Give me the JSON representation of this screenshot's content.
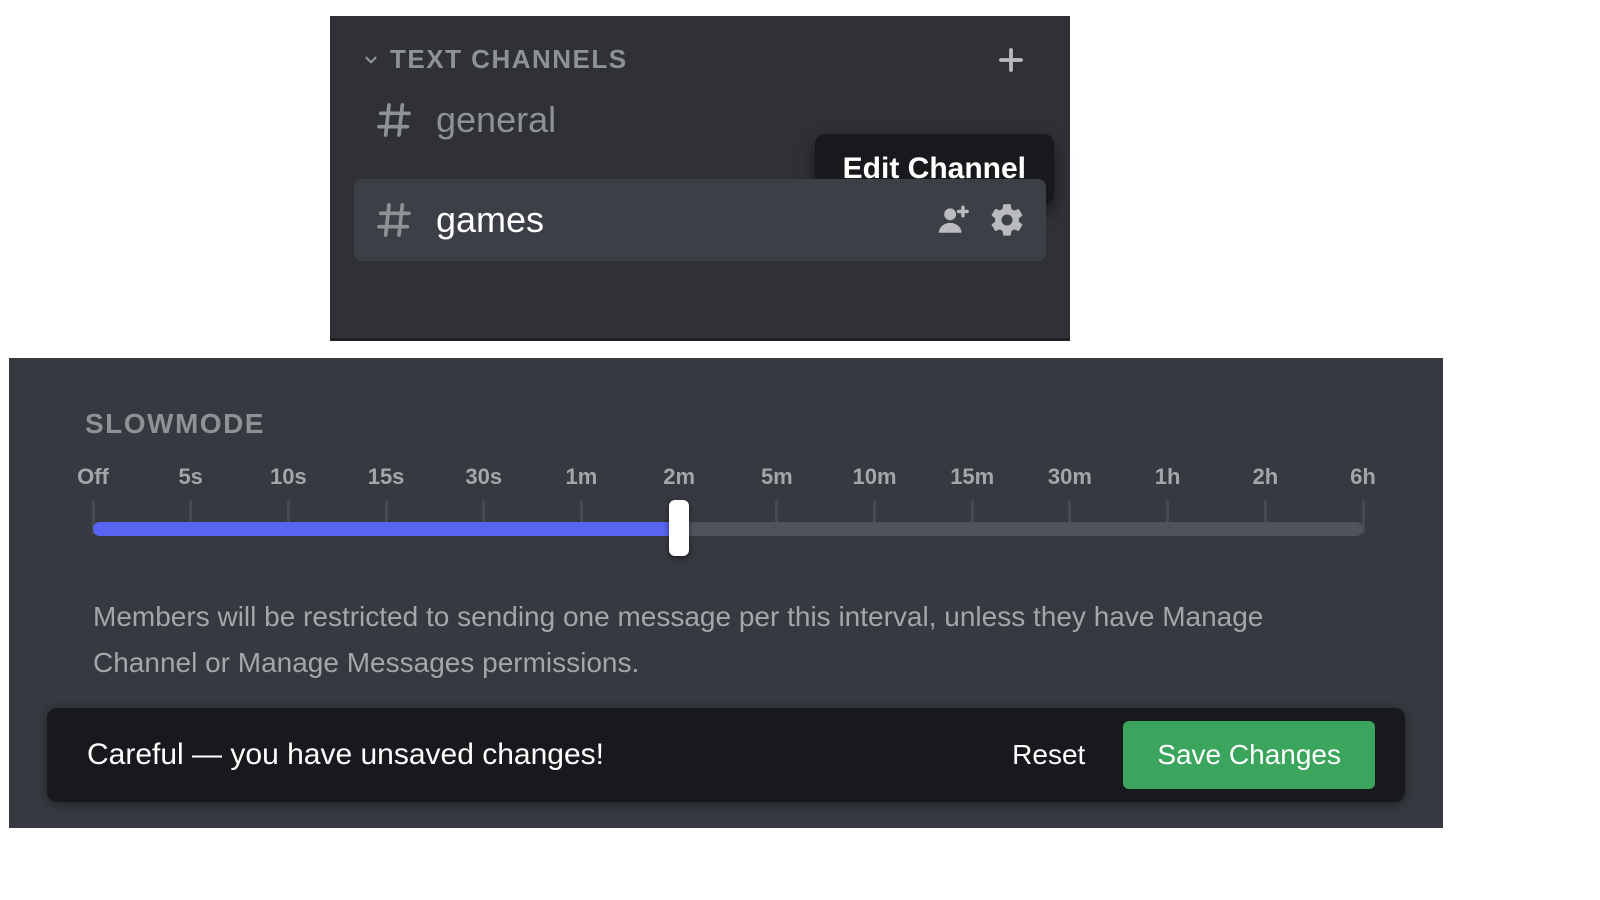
{
  "sidebar": {
    "category_label": "TEXT CHANNELS",
    "channels": [
      {
        "name": "general",
        "active": false
      },
      {
        "name": "games",
        "active": true
      }
    ],
    "tooltip": "Edit Channel"
  },
  "slowmode": {
    "label": "SLOWMODE",
    "ticks": [
      "Off",
      "5s",
      "10s",
      "15s",
      "30s",
      "1m",
      "2m",
      "5m",
      "10m",
      "15m",
      "30m",
      "1h",
      "2h",
      "6h"
    ],
    "selected_index": 6,
    "description": "Members will be restricted to sending one message per this interval, unless they have Manage Channel or Manage Messages permissions."
  },
  "save_bar": {
    "message": "Careful — you have unsaved changes!",
    "reset_label": "Reset",
    "save_label": "Save Changes"
  },
  "colors": {
    "accent": "#5865f2",
    "success": "#3ba55d"
  }
}
